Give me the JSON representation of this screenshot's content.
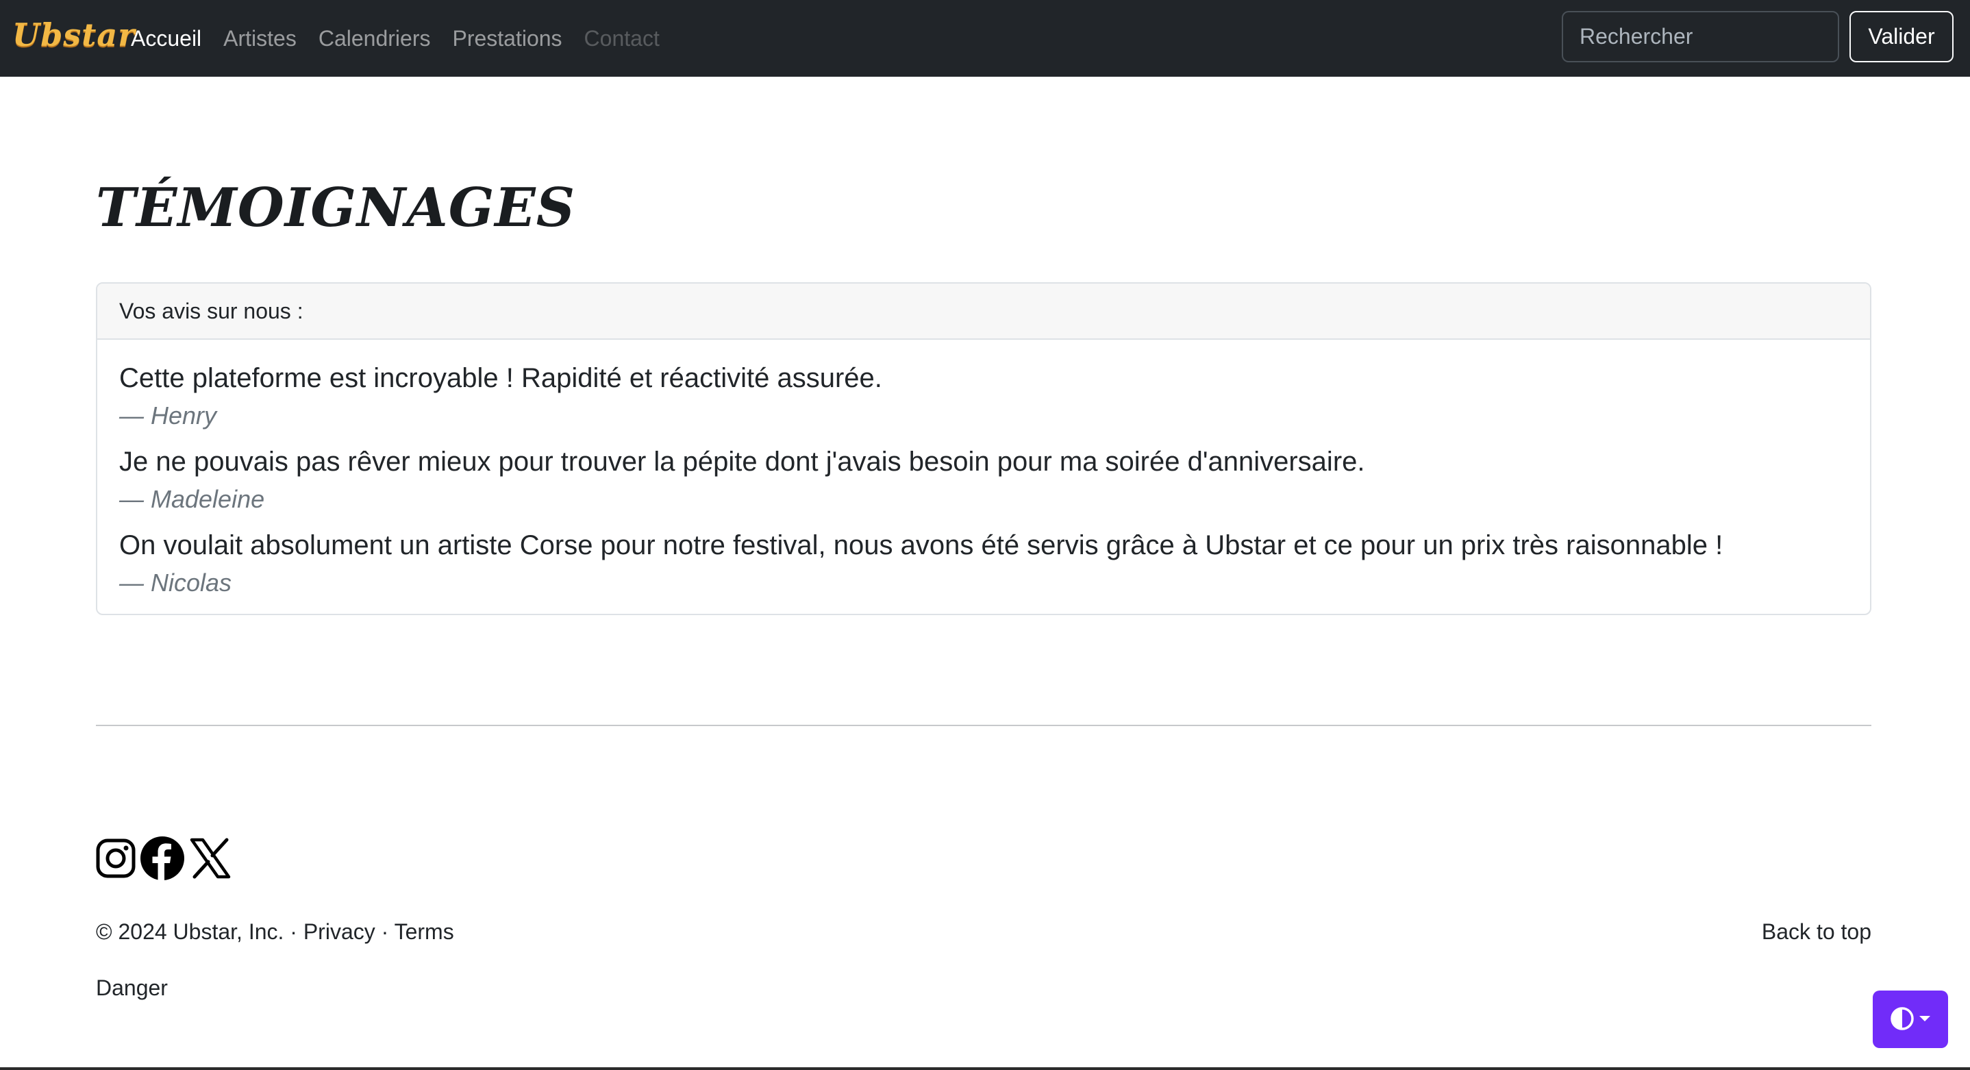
{
  "navbar": {
    "brand": "Ubstar",
    "links": [
      {
        "label": "Accueil",
        "state": "active"
      },
      {
        "label": "Artistes",
        "state": "normal"
      },
      {
        "label": "Calendriers",
        "state": "normal"
      },
      {
        "label": "Prestations",
        "state": "normal"
      },
      {
        "label": "Contact",
        "state": "disabled"
      }
    ],
    "search_placeholder": "Rechercher",
    "search_button": "Valider"
  },
  "main": {
    "title": "TÉMOIGNAGES",
    "card_header": "Vos avis sur nous :",
    "testimonials": [
      {
        "quote": "Cette plateforme est incroyable ! Rapidité et réactivité assurée.",
        "author": "— Henry"
      },
      {
        "quote": "Je ne pouvais pas rêver mieux pour trouver la pépite dont j'avais besoin pour ma soirée d'anniversaire.",
        "author": "— Madeleine"
      },
      {
        "quote": "On voulait absolument un artiste Corse pour notre festival, nous avons été servis grâce à Ubstar et ce pour un prix très raisonnable !",
        "author": "— Nicolas"
      }
    ]
  },
  "footer": {
    "social_icons": [
      "instagram-icon",
      "facebook-icon",
      "x-icon"
    ],
    "copyright": "© 2024 Ubstar, Inc.",
    "separator": " · ",
    "privacy": "Privacy",
    "terms": "Terms",
    "back_to_top": "Back to top",
    "danger": "Danger"
  },
  "theme_toggle": {
    "icon": "half-circle-contrast-icon",
    "accent_color": "#712cf9"
  },
  "colors": {
    "navbar_bg": "#212529",
    "brand": "#f2b845"
  }
}
